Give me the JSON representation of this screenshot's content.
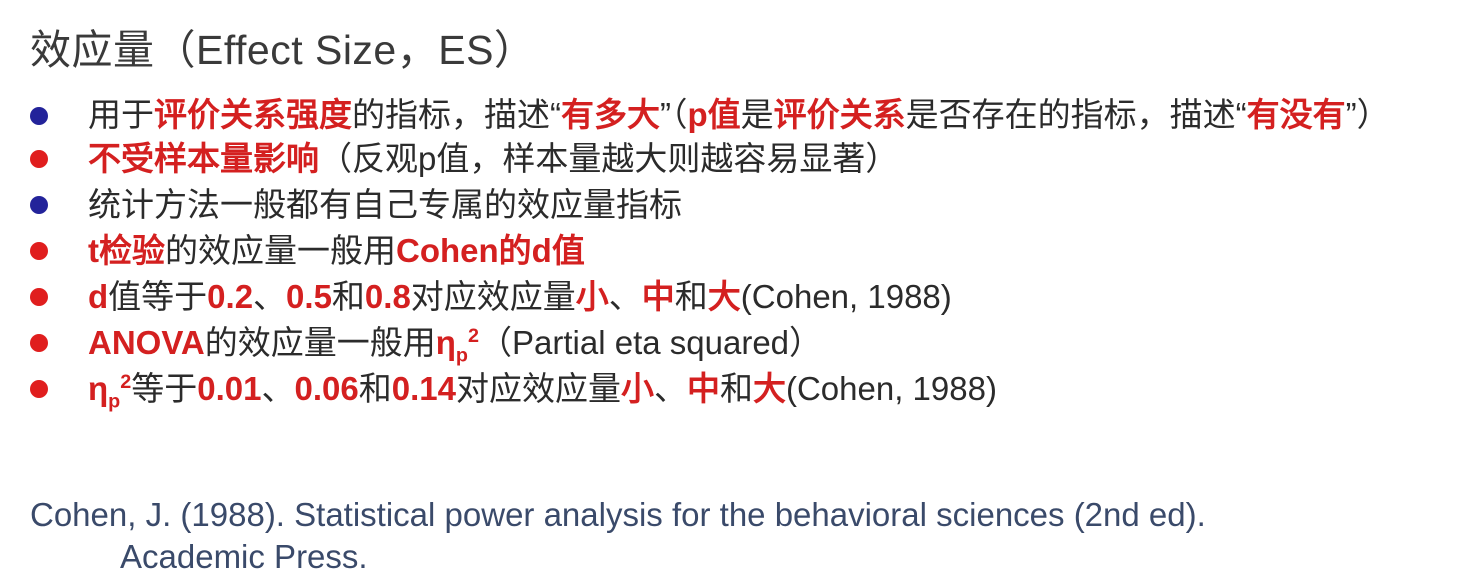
{
  "title": "效应量（Effect Size，ES）",
  "bullets": [
    {
      "dot_color": "#23239a",
      "seg1": "用于",
      "seg2": "评价关系强度",
      "seg3": "的指标，描述“",
      "seg4": "有多大",
      "seg5": "”（",
      "seg6": "p值",
      "seg7": "是",
      "seg8": "评价关系",
      "seg9": "是否存在的指标，描述“",
      "seg10": "有没有",
      "seg11": "”）"
    },
    {
      "dot_color": "#e01e1e",
      "seg1": "不受样本量影响",
      "seg2": "（反观p值，样本量越大则越容易显著）"
    },
    {
      "dot_color": "#23239a",
      "seg1": "统计方法一般都有自己专属的效应量指标"
    },
    {
      "dot_color": "#e01e1e",
      "seg1": "t检验",
      "seg2": "的效应量一般用",
      "seg3": "Cohen的d值"
    },
    {
      "dot_color": "#e01e1e",
      "seg1": "d",
      "seg2": "值等于",
      "seg3": "0.2",
      "seg4": "、",
      "seg5": "0.5",
      "seg6": "和",
      "seg7": "0.8",
      "seg8": "对应效应量",
      "seg9": "小",
      "seg10": "、",
      "seg11": "中",
      "seg12": "和",
      "seg13": "大",
      "seg14": "(Cohen, 1988)"
    },
    {
      "dot_color": "#e01e1e",
      "seg1": "ANOVA",
      "seg2": "的效应量一般用",
      "eta": "η",
      "eta_sub": "p",
      "eta_sup": "2",
      "seg3": "（Partial eta squared）"
    },
    {
      "dot_color": "#e01e1e",
      "eta": "η",
      "eta_sub": "p",
      "eta_sup": "2",
      "seg1": "等于",
      "seg2": "0.01",
      "seg3": "、",
      "seg4": "0.06",
      "seg5": "和",
      "seg6": "0.14",
      "seg7": "对应效应量",
      "seg8": "小",
      "seg9": "、",
      "seg10": "中",
      "seg11": "和",
      "seg12": "大",
      "seg13": "(Cohen, 1988)"
    }
  ],
  "reference": {
    "line1": "Cohen, J. (1988). Statistical power analysis for the behavioral sciences (2nd ed).",
    "line2": "Academic Press."
  },
  "colors": {
    "accent_red": "#d42020",
    "bullet_blue": "#23239a",
    "bullet_red": "#e01e1e",
    "body_text": "#2b2b2b",
    "reference_text": "#3a4a6a"
  }
}
